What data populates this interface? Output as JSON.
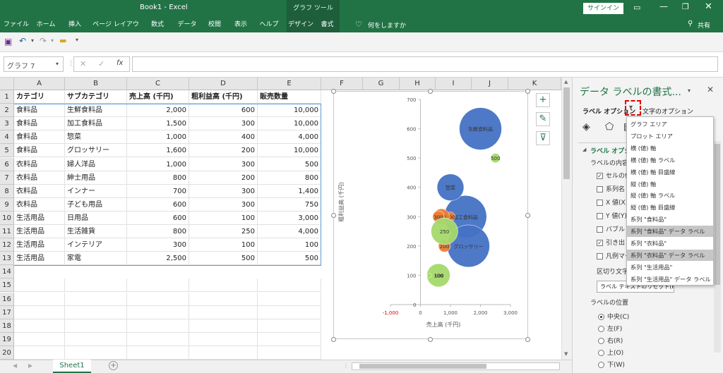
{
  "window": {
    "title": "Book1  -  Excel",
    "context_tool": "グラフ ツール",
    "signin_label": "サインイン",
    "share_label": "共有"
  },
  "ribbon": {
    "tabs": [
      "ファイル",
      "ホーム",
      "挿入",
      "ページ レイアウト",
      "数式",
      "データ",
      "校閲",
      "表示",
      "ヘルプ",
      "デザイン",
      "書式"
    ],
    "tell_me": "何をしますか"
  },
  "formula_bar": {
    "name_box": "グラフ 7",
    "fx": "fx",
    "value": ""
  },
  "sheet": {
    "columns": [
      "A",
      "B",
      "C",
      "D",
      "E",
      "F",
      "G",
      "H",
      "I",
      "J",
      "K"
    ],
    "row_numbers": [
      "1",
      "2",
      "3",
      "4",
      "5",
      "6",
      "7",
      "8",
      "9",
      "10",
      "11",
      "12",
      "13",
      "14",
      "15",
      "16",
      "17",
      "18",
      "19",
      "20"
    ],
    "header": [
      "カテゴリ",
      "サブカテゴリ",
      "売上高 (千円)",
      "粗利益高 (千円)",
      "販売数量"
    ],
    "rows": [
      [
        "食料品",
        "生鮮食料品",
        "2,000",
        "600",
        "10,000"
      ],
      [
        "食料品",
        "加工食料品",
        "1,500",
        "300",
        "10,000"
      ],
      [
        "食料品",
        "惣菜",
        "1,000",
        "400",
        "4,000"
      ],
      [
        "食料品",
        "グロッサリー",
        "1,600",
        "200",
        "10,000"
      ],
      [
        "衣料品",
        "婦人洋品",
        "1,000",
        "300",
        "500"
      ],
      [
        "衣料品",
        "紳士用品",
        "800",
        "200",
        "800"
      ],
      [
        "衣料品",
        "インナー",
        "700",
        "300",
        "1,400"
      ],
      [
        "衣料品",
        "子ども用品",
        "600",
        "300",
        "750"
      ],
      [
        "生活用品",
        "日用品",
        "600",
        "100",
        "3,000"
      ],
      [
        "生活用品",
        "生活雑貨",
        "800",
        "250",
        "4,000"
      ],
      [
        "生活用品",
        "インテリア",
        "300",
        "100",
        "100"
      ],
      [
        "生活用品",
        "家電",
        "2,500",
        "500",
        "500"
      ]
    ],
    "tab_name": "Sheet1"
  },
  "chart_data": {
    "type": "scatter",
    "subtype": "bubble",
    "xlabel": "売上高 (千円)",
    "ylabel": "粗利益高 (千円)",
    "xlim": [
      -1000,
      3000
    ],
    "ylim": [
      0,
      700
    ],
    "x_ticks": [
      "-1,000",
      "0",
      "1,000",
      "2,000",
      "3,000"
    ],
    "y_ticks": [
      "0",
      "100",
      "200",
      "300",
      "400",
      "500",
      "600",
      "700"
    ],
    "series": [
      {
        "name": "食料品",
        "color": "#4472c4",
        "points": [
          {
            "x": 2000,
            "y": 600,
            "size": 10000,
            "label": "生鮮食料品"
          },
          {
            "x": 1500,
            "y": 300,
            "size": 10000,
            "label": "加工食料品"
          },
          {
            "x": 1000,
            "y": 400,
            "size": 4000,
            "label": "惣菜"
          },
          {
            "x": 1600,
            "y": 200,
            "size": 10000,
            "label": "グロッサリー"
          }
        ]
      },
      {
        "name": "衣料品",
        "color": "#ed7d31",
        "points": [
          {
            "x": 1000,
            "y": 300,
            "size": 500,
            "label": "300"
          },
          {
            "x": 800,
            "y": 200,
            "size": 800,
            "label": "200"
          },
          {
            "x": 700,
            "y": 300,
            "size": 1400,
            "label": "300"
          },
          {
            "x": 600,
            "y": 300,
            "size": 750,
            "label": "300"
          }
        ]
      },
      {
        "name": "生活用品",
        "color": "#a5d86a",
        "points": [
          {
            "x": 600,
            "y": 100,
            "size": 3000,
            "label": "100"
          },
          {
            "x": 800,
            "y": 250,
            "size": 4000,
            "label": "250"
          },
          {
            "x": 300,
            "y": 100,
            "size": 100,
            "label": "100"
          },
          {
            "x": 2500,
            "y": 500,
            "size": 500,
            "label": "500"
          }
        ]
      }
    ]
  },
  "pane": {
    "title": "データ ラベルの書式...",
    "tab_label_options": "ラベル オプション",
    "tab_text_options": "文字のオプション",
    "section_label": "ラベル オプション",
    "label_contains": "ラベルの内容",
    "checkboxes": [
      {
        "label": "セルの値",
        "checked": true
      },
      {
        "label": "系列名",
        "checked": false
      },
      {
        "label": "X 値(X)",
        "checked": false
      },
      {
        "label": "Y 値(Y)",
        "checked": false
      },
      {
        "label": "バブル サイズ",
        "checked": false
      },
      {
        "label": "引き出し線",
        "checked": true
      },
      {
        "label": "凡例マーカー",
        "checked": false
      }
    ],
    "separator_label": "区切り文字",
    "reset_button": "ラベル テキストのリセット(R)",
    "position_label": "ラベルの位置",
    "positions": [
      {
        "label": "中央(C)",
        "selected": true
      },
      {
        "label": "左(F)",
        "selected": false
      },
      {
        "label": "右(R)",
        "selected": false
      },
      {
        "label": "上(O)",
        "selected": false
      },
      {
        "label": "下(W)",
        "selected": false
      }
    ]
  },
  "dropdown": {
    "items": [
      {
        "label": "グラフ エリア",
        "selected": false
      },
      {
        "label": "プロット エリア",
        "selected": false
      },
      {
        "label": "横 (値) 軸",
        "selected": false
      },
      {
        "label": "横 (値) 軸 ラベル",
        "selected": false
      },
      {
        "label": "横 (値) 軸 目盛線",
        "selected": false
      },
      {
        "label": "縦 (値) 軸",
        "selected": false
      },
      {
        "label": "縦 (値) 軸 ラベル",
        "selected": false
      },
      {
        "label": "縦 (値) 軸 目盛線",
        "selected": false
      },
      {
        "label": "系列 \"食料品\"",
        "selected": false
      },
      {
        "label": "系列 \"食料品\" データ ラベル",
        "selected": true
      },
      {
        "label": "系列 \"衣料品\"",
        "selected": false
      },
      {
        "label": "系列 \"衣料品\" データ ラベル",
        "selected": true
      },
      {
        "label": "系列 \"生活用品\"",
        "selected": false
      },
      {
        "label": "系列 \"生活用品\" データ ラベル",
        "selected": false
      }
    ]
  }
}
